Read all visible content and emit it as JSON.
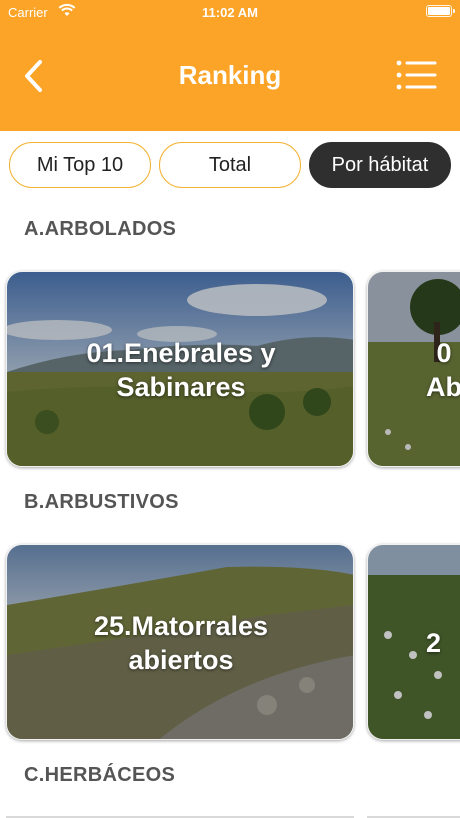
{
  "status_bar": {
    "carrier": "Carrier",
    "time": "11:02 AM"
  },
  "header": {
    "title": "Ranking",
    "back_icon": "chevron-left-icon",
    "menu_icon": "list-icon"
  },
  "colors": {
    "accent": "#fba428",
    "segment_border": "#f3b233",
    "segment_active": "#2f2f2f"
  },
  "segments": [
    {
      "label": "Mi Top 10",
      "selected": false
    },
    {
      "label": "Total",
      "selected": false
    },
    {
      "label": "Por hábitat",
      "selected": true
    }
  ],
  "sections": [
    {
      "title": "A.ARBOLADOS",
      "cards": [
        {
          "label": "01.Enebrales y\nSabinares"
        },
        {
          "label": "0\nAb"
        }
      ]
    },
    {
      "title": "B.ARBUSTIVOS",
      "cards": [
        {
          "label": "25.Matorrales\nabiertos"
        },
        {
          "label": "2"
        }
      ]
    },
    {
      "title": "C.HERBÁCEOS",
      "cards": []
    }
  ]
}
